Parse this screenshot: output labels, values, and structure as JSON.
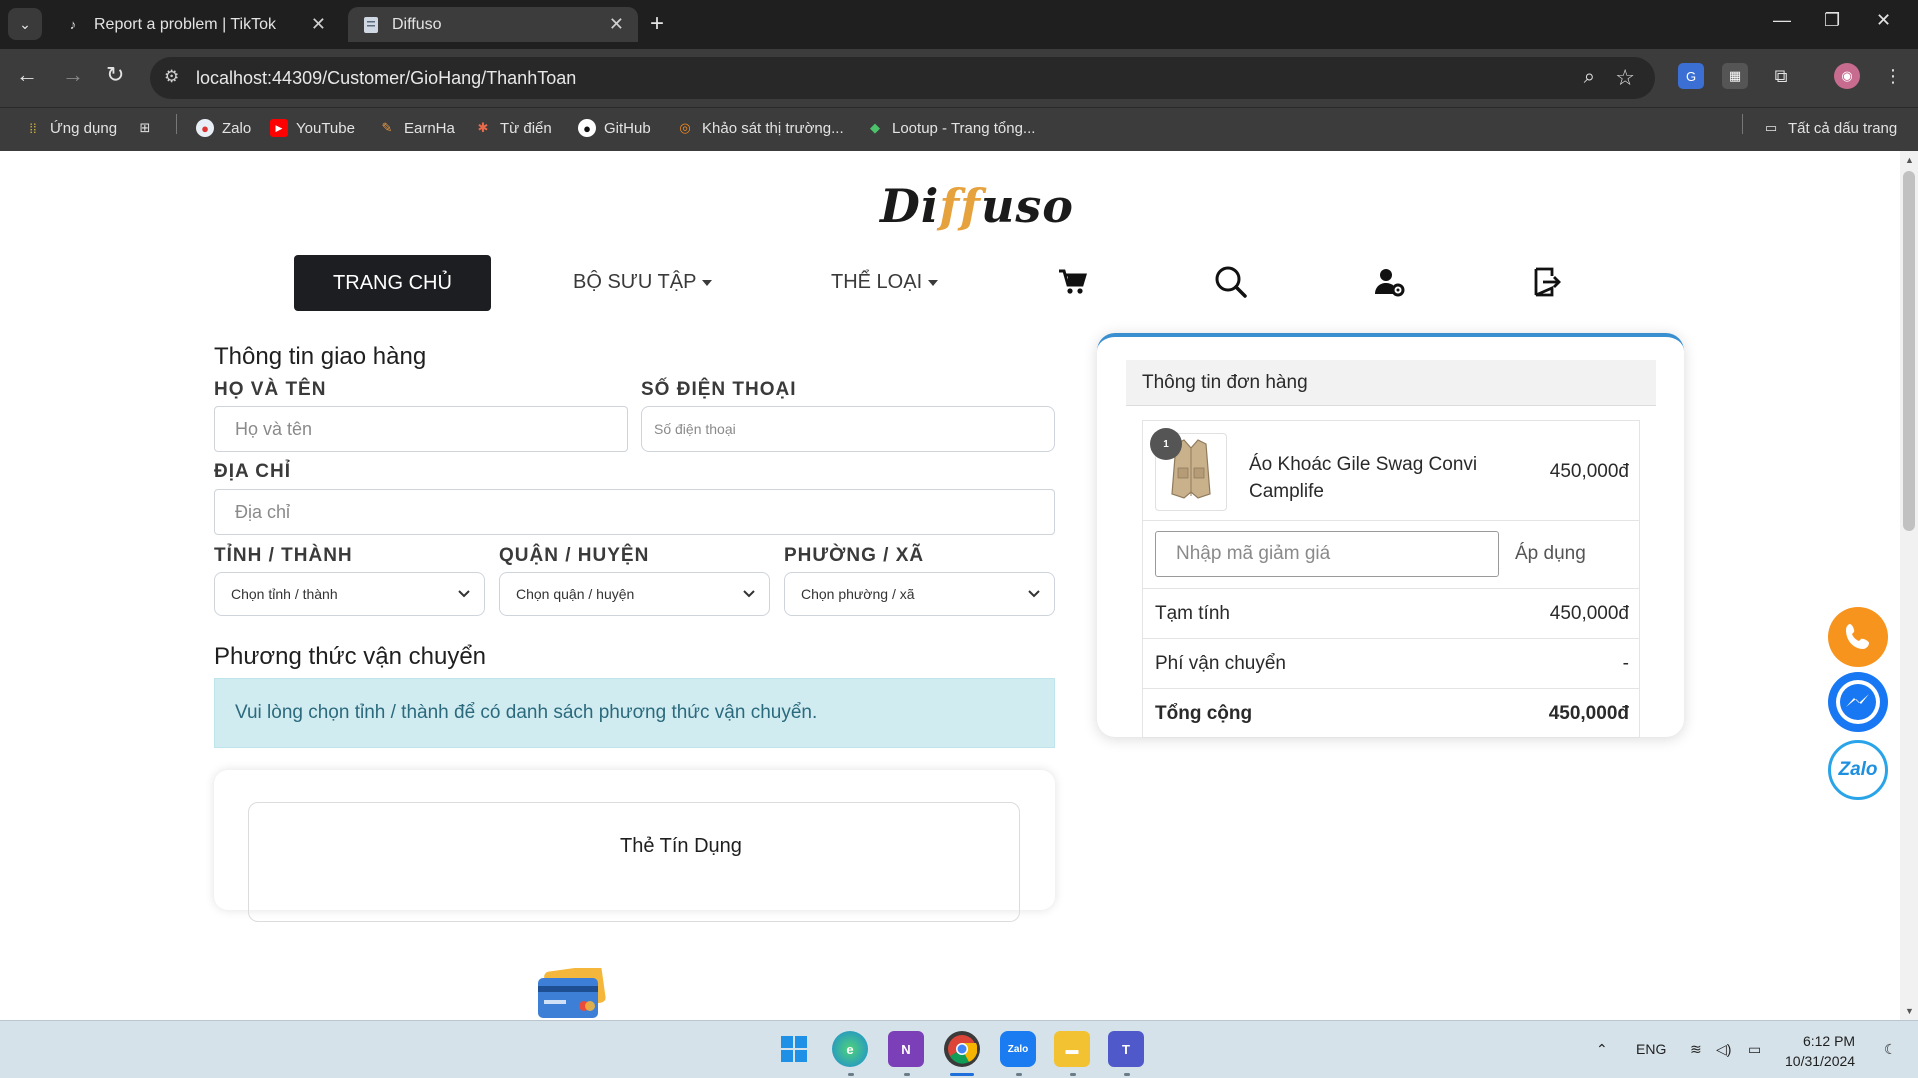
{
  "browser": {
    "tabs": [
      {
        "title": "Report a problem | TikTok",
        "active": false,
        "icon": "tiktok-icon"
      },
      {
        "title": "Diffuso",
        "active": true,
        "icon": "page-icon"
      }
    ],
    "url": "localhost:44309/Customer/GioHang/ThanhToan",
    "bookmarks": [
      {
        "label": "Ứng dụng",
        "icon": "apps-grid-icon"
      },
      {
        "label": "Zalo",
        "icon": "zalo-icon"
      },
      {
        "label": "YouTube",
        "icon": "youtube-icon"
      },
      {
        "label": "EarnHa",
        "icon": "earnha-icon"
      },
      {
        "label": "Từ điển",
        "icon": "dictionary-icon"
      },
      {
        "label": "GitHub",
        "icon": "github-icon"
      },
      {
        "label": "Khảo sát thị trường...",
        "icon": "survey-icon"
      },
      {
        "label": "Lootup - Trang tổng...",
        "icon": "lootup-icon"
      }
    ],
    "all_bookmarks": "Tất cả dấu trang"
  },
  "site": {
    "logo_pre": "Di",
    "logo_ff": "ff",
    "logo_post": "uso",
    "nav": {
      "home": "TRANG CHỦ",
      "collection": "BỘ SƯU TẬP",
      "category": "THỂ LOẠI"
    }
  },
  "shipping": {
    "title": "Thông tin giao hàng",
    "name_label": "HỌ VÀ TÊN",
    "name_placeholder": "Họ và tên",
    "phone_label": "SỐ ĐIỆN THOẠI",
    "phone_placeholder": "Số điện thoại",
    "address_label": "ĐỊA CHỈ",
    "address_placeholder": "Địa chỉ",
    "province_label": "TỈNH / THÀNH",
    "province_value": "Chọn tỉnh / thành",
    "district_label": "QUẬN / HUYỆN",
    "district_value": "Chọn quận / huyện",
    "ward_label": "PHƯỜNG / XÃ",
    "ward_value": "Chọn phường / xã"
  },
  "shipping_method": {
    "title": "Phương thức vận chuyển",
    "notice": "Vui lòng chọn tỉnh / thành để có danh sách phương thức vận chuyển."
  },
  "payment": {
    "credit_card_label": "Thẻ Tín Dụng"
  },
  "order": {
    "title": "Thông tin đơn hàng",
    "items": [
      {
        "name": "Áo Khoác Gile Swag Convi Camplife",
        "price": "450,000đ",
        "qty": "1"
      }
    ],
    "coupon_placeholder": "Nhập mã giảm giá",
    "apply_label": "Áp dụng",
    "subtotal_label": "Tạm tính",
    "subtotal_value": "450,000đ",
    "shipping_label": "Phí vận chuyển",
    "shipping_value": "-",
    "total_label": "Tổng cộng",
    "total_value": "450,000đ"
  },
  "taskbar": {
    "lang": "ENG",
    "time": "6:12 PM",
    "date": "10/31/2024"
  },
  "colors": {
    "accent": "#3a8fd1",
    "phone_button": "#f7941d",
    "messenger_button": "#1877f2",
    "dark_button": "#1c1e21"
  }
}
